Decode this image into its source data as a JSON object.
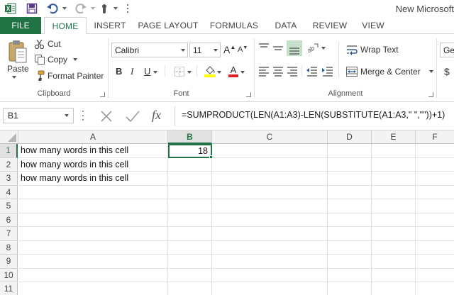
{
  "app": {
    "title": "New Microsoft",
    "brand_color": "#217346",
    "quick_access": [
      "excel-icon",
      "save-icon",
      "undo-icon",
      "redo-icon",
      "touch-mode-icon",
      "customize-icon"
    ]
  },
  "tabs": {
    "file": "FILE",
    "items": [
      "HOME",
      "INSERT",
      "PAGE LAYOUT",
      "FORMULAS",
      "DATA",
      "REVIEW",
      "VIEW"
    ],
    "active": "HOME"
  },
  "ribbon": {
    "clipboard": {
      "label": "Clipboard",
      "paste": "Paste",
      "cut": "Cut",
      "copy": "Copy",
      "format_painter": "Format Painter"
    },
    "font": {
      "label": "Font",
      "name": "Calibri",
      "size": "11",
      "bold": "B",
      "italic": "I",
      "underline": "U"
    },
    "alignment": {
      "label": "Alignment",
      "wrap_text": "Wrap Text",
      "merge_center": "Merge & Center"
    },
    "number": {
      "format": "Ger",
      "currency": "$"
    }
  },
  "formula_bar": {
    "name_box": "B1",
    "fx": "fx",
    "formula": "=SUMPRODUCT(LEN(A1:A3)-LEN(SUBSTITUTE(A1:A3,\" \",\"\"))+1)"
  },
  "sheet": {
    "columns": [
      "A",
      "B",
      "C",
      "D",
      "E",
      "F"
    ],
    "rows": [
      "1",
      "2",
      "3",
      "4",
      "5",
      "6",
      "7",
      "8",
      "9",
      "10",
      "11"
    ],
    "cells": {
      "A1": "how many words in this cell",
      "A2": "how many words in this cell",
      "A3": "how many words in this cell",
      "B1": "18"
    },
    "active_cell": "B1"
  }
}
